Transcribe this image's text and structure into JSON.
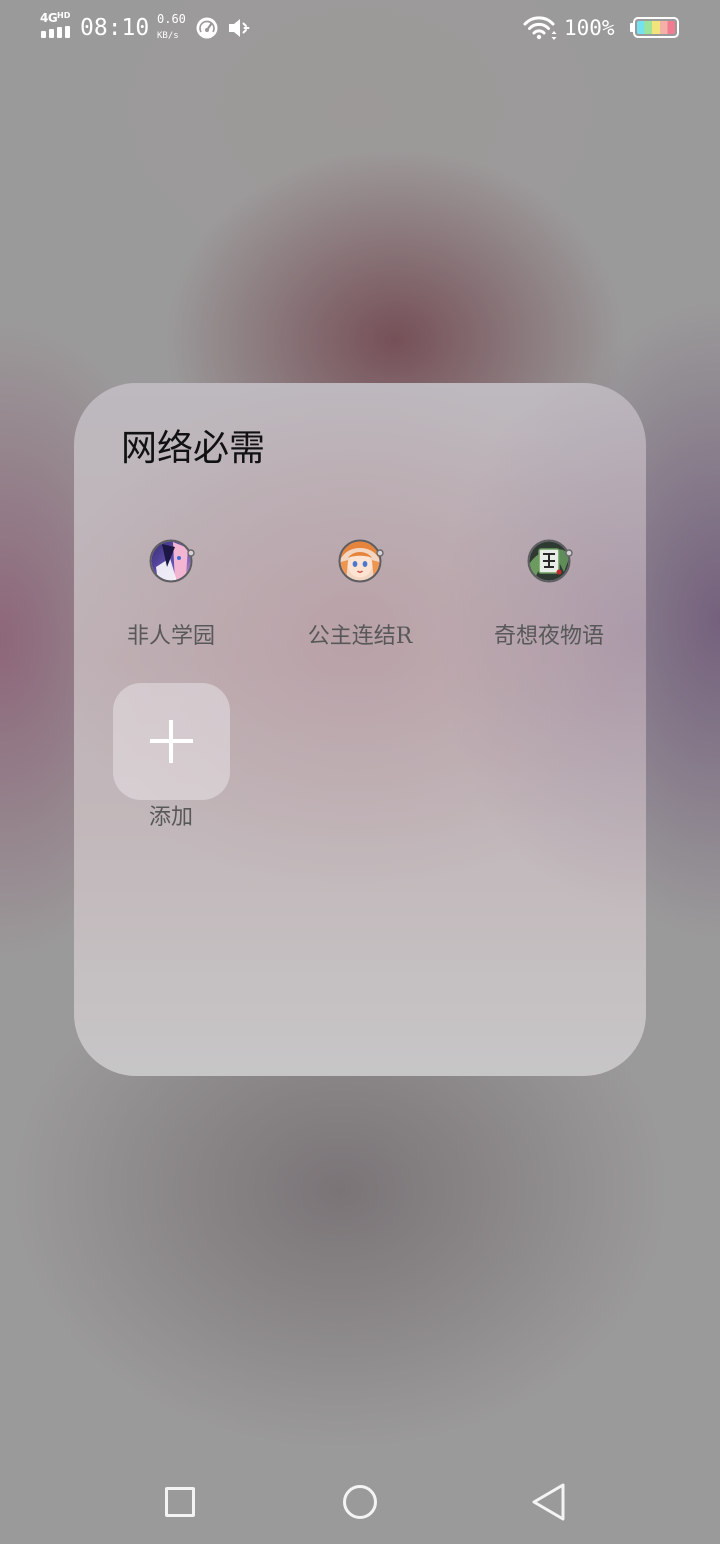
{
  "status_bar": {
    "network_type": "4G",
    "network_badge": "HD",
    "time": "08:10",
    "speed_value": "0.60",
    "speed_unit": "KB/s",
    "battery_percent": "100%",
    "battery_level": 1.0,
    "icons": {
      "signal": "cellular-signal-icon",
      "speed": "speedometer-icon",
      "sound": "mute-icon",
      "wifi": "wifi-icon",
      "battery": "battery-icon"
    }
  },
  "folder": {
    "title": "网络必需",
    "apps": [
      {
        "label": "非人学园",
        "icon": "app-icon-feirenxueyuan"
      },
      {
        "label": "公主连结R",
        "icon": "app-icon-gongzhulianjie"
      },
      {
        "label": "奇想夜物语",
        "icon": "app-icon-qixiangyewuyu"
      }
    ],
    "add_button": {
      "label": "添加",
      "icon": "plus-icon"
    }
  },
  "nav_bar": {
    "recents_icon": "recents-square-icon",
    "home_icon": "home-circle-icon",
    "back_icon": "back-triangle-icon"
  },
  "colors": {
    "status_text": "#ffffff",
    "folder_title": "#111111",
    "app_label": "#585858",
    "battery_stripes": [
      "#74e3ef",
      "#9fe39a",
      "#f2e47a",
      "#f5b0a8",
      "#f27c8f"
    ]
  }
}
